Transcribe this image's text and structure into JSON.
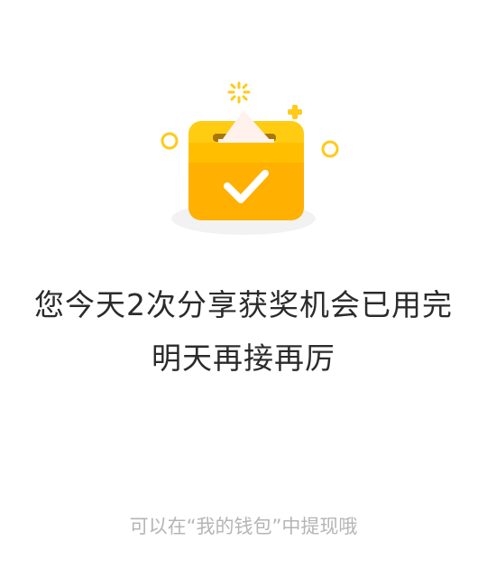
{
  "message": {
    "line1": "您今天2次分享获奖机会已用完",
    "line2": "明天再接再厉"
  },
  "hint": "可以在“我的钱包”中提现哦",
  "colors": {
    "box": "#ffc400",
    "box_dark": "#ffa800",
    "paper": "#fff1ec",
    "accent": "#ffca1a",
    "shadow": "#f2f2f2",
    "text": "#2b2b2b",
    "hint_text": "#b5b5b5"
  },
  "icons": {
    "illustration": "completed-ballot-box-icon",
    "check": "checkmark-icon"
  }
}
